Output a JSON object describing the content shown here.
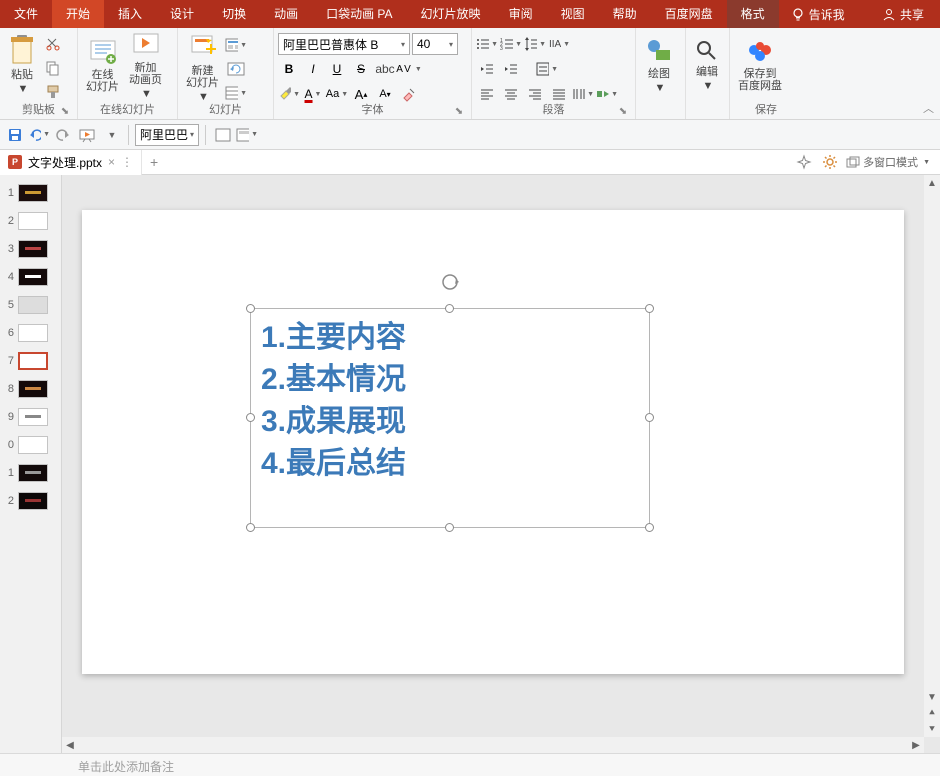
{
  "tabs": {
    "file": "文件",
    "home": "开始",
    "insert": "插入",
    "design": "设计",
    "transitions": "切换",
    "animations": "动画",
    "pocket": "口袋动画 PA",
    "slideshow": "幻灯片放映",
    "review": "审阅",
    "view": "视图",
    "help": "帮助",
    "baidu": "百度网盘",
    "format": "格式",
    "tell": "告诉我",
    "share": "共享"
  },
  "ribbon": {
    "clipboard": {
      "paste": "粘贴",
      "label": "剪贴板"
    },
    "online": {
      "slide": "在线\n幻灯片",
      "anim": "新加\n动画页",
      "label": "在线幻灯片"
    },
    "slides": {
      "new": "新建\n幻灯片",
      "label": "幻灯片"
    },
    "font": {
      "name": "阿里巴巴普惠体 B",
      "size": "40",
      "label": "字体"
    },
    "paragraph": {
      "label": "段落"
    },
    "drawing": {
      "label": "绘图"
    },
    "editing": {
      "label": "编辑"
    },
    "save": {
      "btn": "保存到\n百度网盘",
      "label": "保存"
    }
  },
  "qat": {
    "fontbox": "阿里巴巴"
  },
  "document": {
    "name": "文字处理.pptx",
    "multiwindow": "多窗口模式"
  },
  "thumbnails": [
    {
      "n": "1",
      "bg": "#1B0D0D",
      "accent": "#C93"
    },
    {
      "n": "2",
      "bg": "#fff"
    },
    {
      "n": "3",
      "bg": "#140A0A",
      "accent": "#B44"
    },
    {
      "n": "4",
      "bg": "#140A0A",
      "accent": "#fff"
    },
    {
      "n": "5",
      "bg": "#DDD"
    },
    {
      "n": "6",
      "bg": "#fff"
    },
    {
      "n": "7",
      "bg": "#fff",
      "selected": true
    },
    {
      "n": "8",
      "bg": "#140A0A",
      "accent": "#C84"
    },
    {
      "n": "9",
      "bg": "#fff",
      "accent": "#888"
    },
    {
      "n": "0",
      "bg": "#fff"
    },
    {
      "n": "1",
      "bg": "#120A0A",
      "accent": "#999"
    },
    {
      "n": "2",
      "bg": "#0D0808",
      "accent": "#933"
    }
  ],
  "textbox": {
    "lines": [
      "1.主要内容",
      "2.基本情况",
      "3.成果展现",
      "4.最后总结"
    ]
  },
  "notes": {
    "placeholder": "单击此处添加备注"
  }
}
